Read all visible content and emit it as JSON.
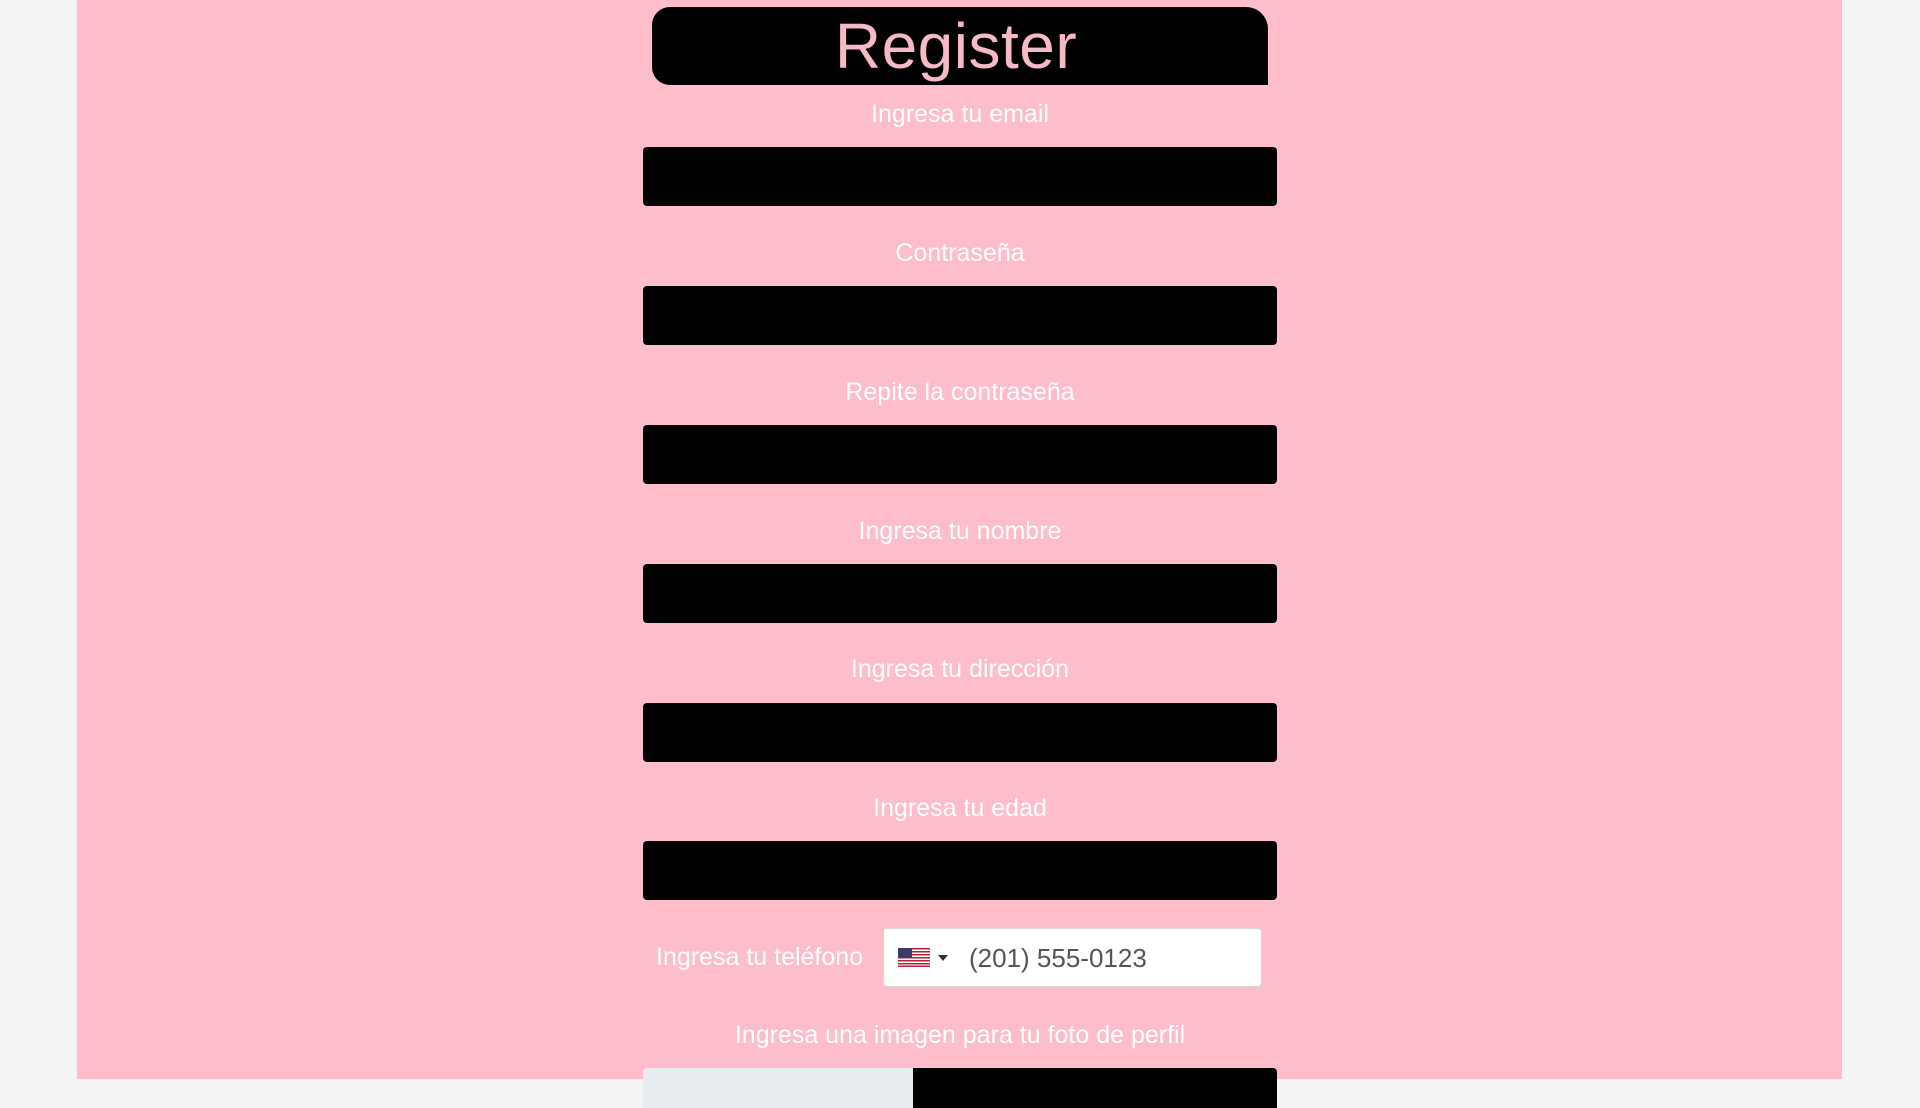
{
  "form": {
    "title": "Register",
    "email_label": "Ingresa tu email",
    "password_label": "Contraseña",
    "repeat_password_label": "Repite la contraseña",
    "name_label": "Ingresa tu nombre",
    "address_label": "Ingresa tu dirección",
    "age_label": "Ingresa tu edad",
    "phone_label": "Ingresa tu teléfono",
    "phone_placeholder": "(201) 555-0123",
    "phone_country": "United States",
    "profile_image_label": "Ingresa una imagen para tu foto de perfil"
  },
  "icons": {
    "flag": "us-flag-icon",
    "caret": "caret-down-icon"
  },
  "colors": {
    "page_background": "#fdbdca",
    "outer_background": "#f4f4f4",
    "title_box": "#000000",
    "title_text": "#f6b9c6",
    "label_text": "#ffffff",
    "field_background": "#000000"
  }
}
